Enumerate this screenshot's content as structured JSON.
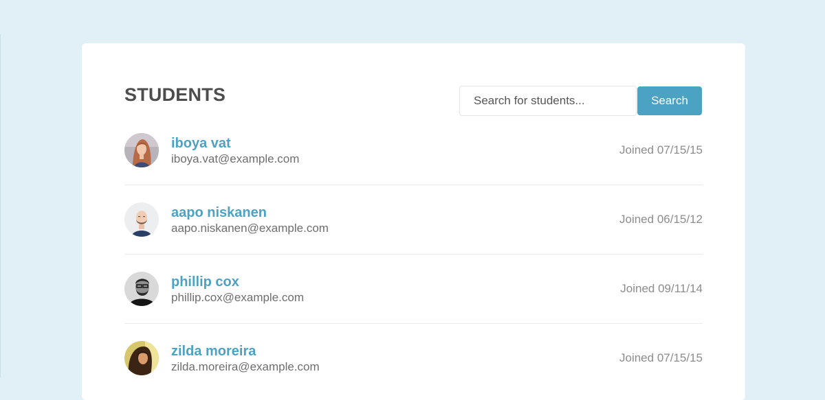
{
  "page": {
    "title": "STUDENTS"
  },
  "search": {
    "placeholder": "Search for students...",
    "value": "",
    "button_label": "Search"
  },
  "students": [
    {
      "name": "iboya vat",
      "email": "iboya.vat@example.com",
      "joined": "Joined 07/15/15",
      "avatar_icon": "woman-red-hair-avatar"
    },
    {
      "name": "aapo niskanen",
      "email": "aapo.niskanen@example.com",
      "joined": "Joined 06/15/12",
      "avatar_icon": "bald-bearded-man-avatar"
    },
    {
      "name": "phillip cox",
      "email": "phillip.cox@example.com",
      "joined": "Joined 09/11/14",
      "avatar_icon": "bearded-man-glasses-avatar"
    },
    {
      "name": "zilda moreira",
      "email": "zilda.moreira@example.com",
      "joined": "Joined 07/15/15",
      "avatar_icon": "woman-long-hair-avatar"
    }
  ],
  "colors": {
    "background": "#e1f0f6",
    "card": "#ffffff",
    "accent": "#4ba2c2",
    "title": "#4d4d4d",
    "email_text": "#6e6e6e",
    "joined_text": "#8c8c8c",
    "divider": "#ebebeb"
  }
}
